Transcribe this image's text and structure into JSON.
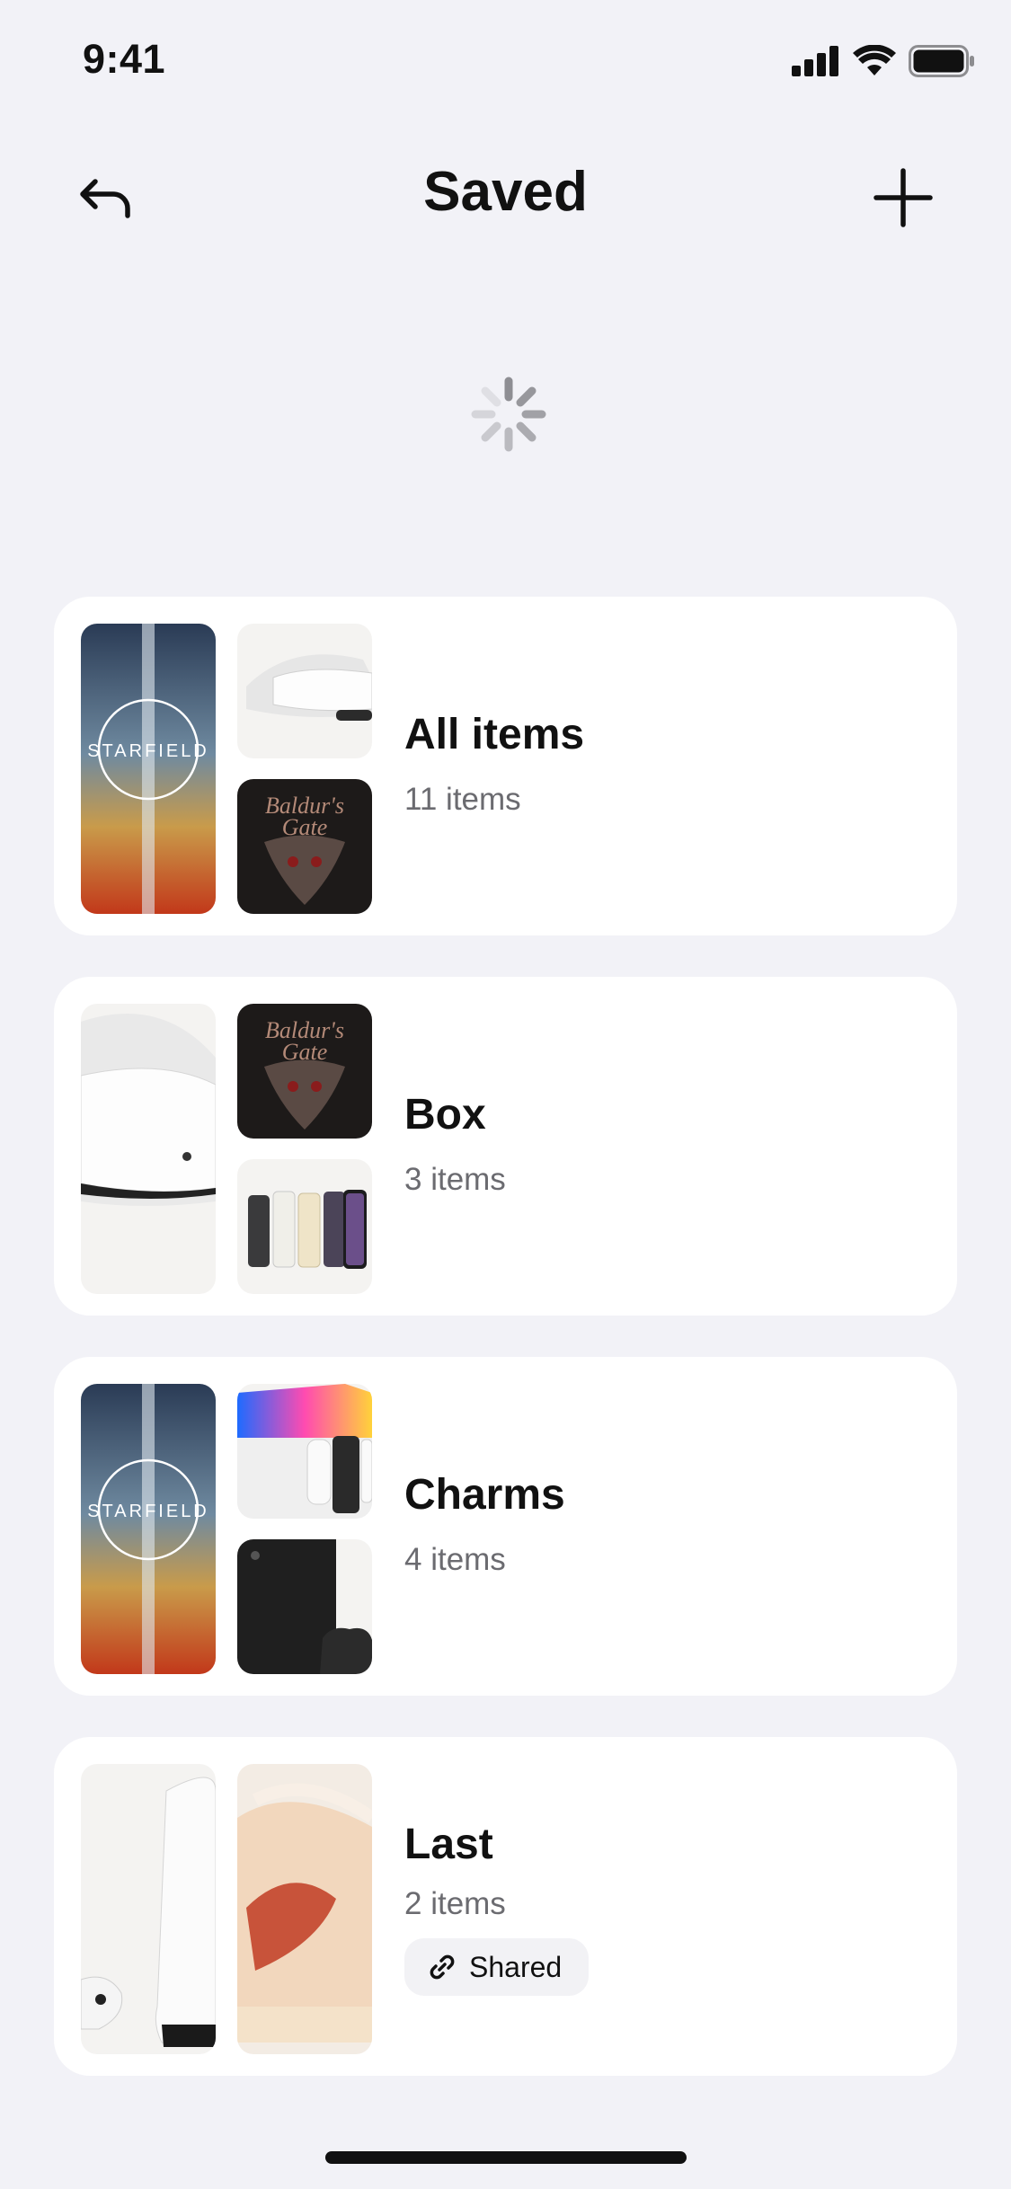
{
  "status_bar": {
    "time": "9:41"
  },
  "header": {
    "title": "Saved"
  },
  "collections": [
    {
      "name": "All items",
      "count": "11 items",
      "thumbs": [
        "starfield-cover",
        "vr-headset",
        "baldurs-gate-cover"
      ]
    },
    {
      "name": "Box",
      "count": "3 items",
      "thumbs": [
        "vr-headset",
        "baldurs-gate-cover",
        "phones"
      ]
    },
    {
      "name": "Charms",
      "count": "4 items",
      "thumbs": [
        "starfield-cover",
        "switch-console",
        "xbox-console"
      ]
    },
    {
      "name": "Last",
      "count": "2 items",
      "thumbs": [
        "ps5-console",
        "sneaker"
      ],
      "badge": "Shared"
    }
  ],
  "icons": {
    "back": "undo-arrow-icon",
    "add": "plus-icon",
    "loading": "spinner-icon",
    "shared": "link-icon"
  }
}
